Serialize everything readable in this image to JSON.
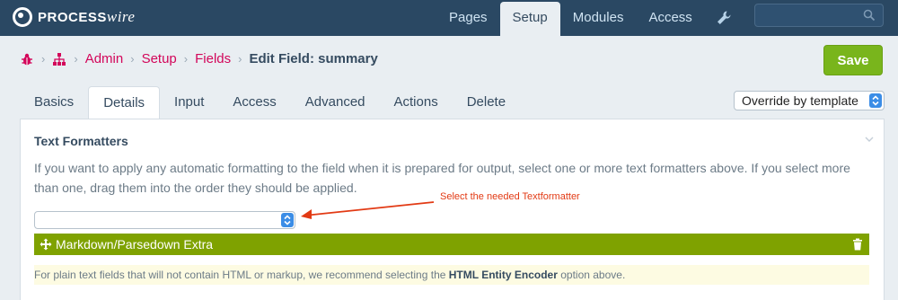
{
  "logo": {
    "part1": "PROCESS",
    "part2": "wire"
  },
  "topnav": {
    "items": [
      {
        "label": "Pages"
      },
      {
        "label": "Setup"
      },
      {
        "label": "Modules"
      },
      {
        "label": "Access"
      }
    ],
    "tools_icon": "wrench-icon",
    "search": {
      "value": "",
      "placeholder": ""
    }
  },
  "breadcrumb": {
    "items": [
      "Admin",
      "Setup",
      "Fields"
    ],
    "current": "Edit Field: summary"
  },
  "save_label": "Save",
  "tabs": [
    {
      "label": "Basics"
    },
    {
      "label": "Details"
    },
    {
      "label": "Input"
    },
    {
      "label": "Access"
    },
    {
      "label": "Advanced"
    },
    {
      "label": "Actions"
    },
    {
      "label": "Delete"
    }
  ],
  "tab_select": {
    "value": "Override by template"
  },
  "panel": {
    "title": "Text Formatters",
    "description": "If you want to apply any automatic formatting to the field when it is prepared for output, select one or more text formatters above. If you select more than one, drag them into the order they should be applied.",
    "select_value": "",
    "annotation": "Select the needed Textformatter",
    "selected_item": "Markdown/Parsedown Extra",
    "notes_before": "For plain text fields that will not contain HTML or markup, we recommend selecting the ",
    "notes_bold": "HTML Entity Encoder",
    "notes_after": " option above."
  },
  "colors": {
    "topbar": "#2a4863",
    "link": "#d3065a",
    "save": "#79b51c",
    "item_bar": "#7fa200",
    "annotation": "#e23a14",
    "select_arrows": "#3b8de6"
  }
}
